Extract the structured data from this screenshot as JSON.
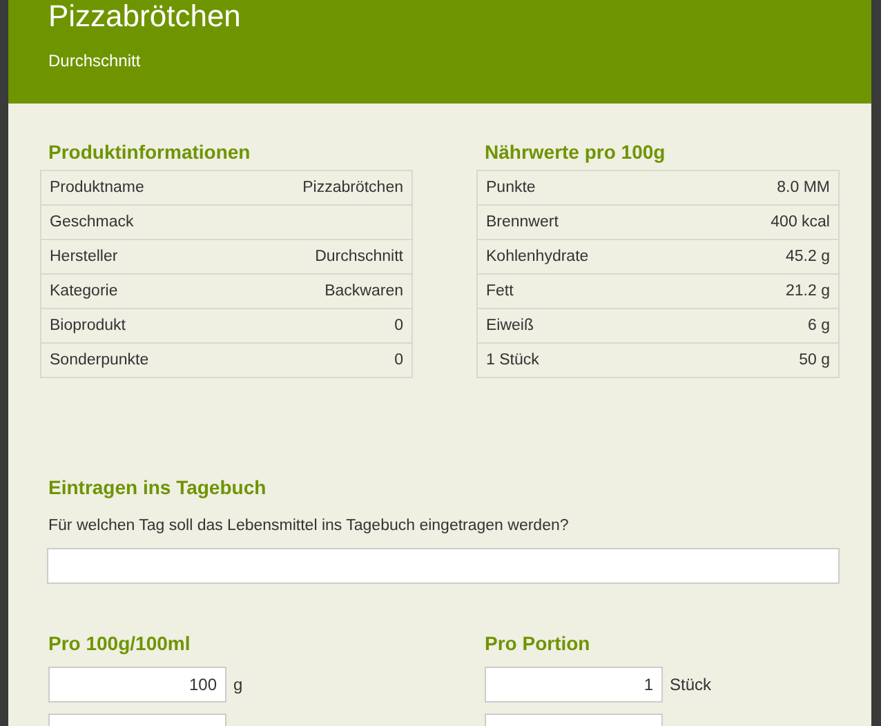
{
  "header": {
    "title": "Pizzabrötchen",
    "subtitle": "Durchschnitt"
  },
  "tables": [
    {
      "title": "Produktinformationen",
      "rows": [
        {
          "label": "Produktname",
          "value": "Pizzabrötchen"
        },
        {
          "label": "Geschmack"
        },
        {
          "label": "Hersteller",
          "value": "Durchschnitt"
        },
        {
          "label": "Kategorie",
          "value": "Backwaren"
        },
        {
          "label": "Bioprodukt",
          "value": "0"
        },
        {
          "label": "Sonderpunkte",
          "value": "0"
        }
      ]
    },
    {
      "title": "Nährwerte pro 100g",
      "rows": [
        {
          "label": "Punkte",
          "value": "8.0 MM"
        },
        {
          "label": "Brennwert",
          "value": "400 kcal"
        },
        {
          "label": "Kohlenhydrate",
          "value": "45.2 g"
        },
        {
          "label": "Fett",
          "value": "21.2 g"
        },
        {
          "label": "Eiweiß",
          "value": "6 g"
        },
        {
          "label": "1 Stück",
          "value": "50 g"
        }
      ]
    }
  ],
  "diary": {
    "title": "Eintragen ins Tagebuch",
    "question": "Für welchen Tag soll das Lebensmittel ins Tagebuch eingetragen werden?"
  },
  "amounts": [
    {
      "title": "Pro 100g/100ml",
      "fields": [
        {
          "kind": "number",
          "value": "100",
          "unit": "g"
        },
        {
          "kind": "partial"
        }
      ]
    },
    {
      "title": "Pro Portion",
      "fields": [
        {
          "kind": "number",
          "value": "1",
          "unit": "Stück"
        },
        {
          "kind": "partial"
        }
      ]
    }
  ]
}
